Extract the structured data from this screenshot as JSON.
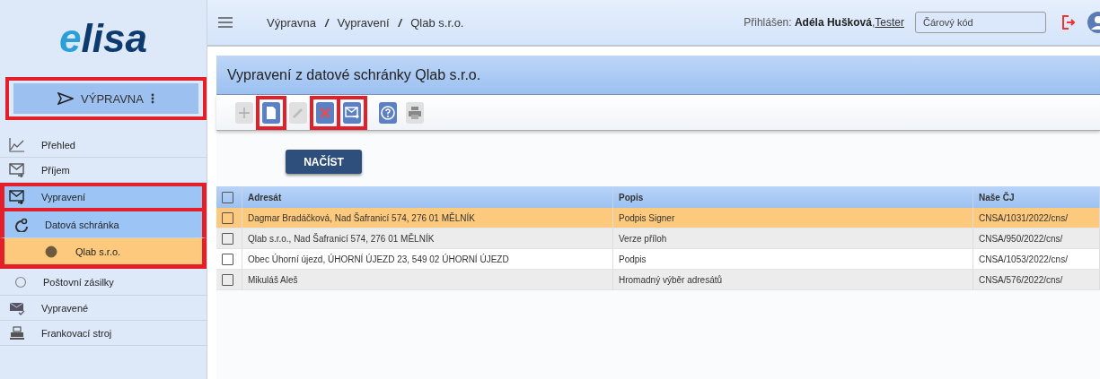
{
  "logo": {
    "text": "lisa",
    "mark": "e"
  },
  "sidebar": {
    "module_button": {
      "label": "VÝPRAVNA",
      "highlighted": true
    },
    "items": [
      {
        "label": "Přehled",
        "selected": false,
        "highlighted": false
      },
      {
        "label": "Příjem",
        "selected": false,
        "highlighted": false
      },
      {
        "label": "Vypravení",
        "selected": true,
        "highlighted": true,
        "children": [
          {
            "label": "Datová schránka",
            "selected": true,
            "highlighted": true,
            "children": [
              {
                "label": "Qlab s.r.o.",
                "selected": true,
                "highlighted": true
              }
            ]
          },
          {
            "label": "Poštovní zásilky",
            "selected": false,
            "highlighted": false
          }
        ]
      },
      {
        "label": "Vypravené",
        "selected": false,
        "highlighted": false
      },
      {
        "label": "Frankovací stroj",
        "selected": false,
        "highlighted": false
      }
    ]
  },
  "topbar": {
    "breadcrumbs": [
      "Výpravna",
      "Vypravení",
      "Qlab s.r.o."
    ],
    "separator": "/",
    "login_label": "Přihlášen:",
    "user": "Adéla Hušková",
    "role_separator": ",",
    "role": "Tester",
    "barcode_placeholder": "Čárový kód"
  },
  "panel": {
    "title": "Vypravení z datové schránky Qlab s.r.o.",
    "toolbar": [
      {
        "kind": "plus",
        "disabled": true,
        "highlighted": false
      },
      {
        "kind": "document",
        "disabled": false,
        "highlighted": true
      },
      {
        "kind": "pencil",
        "disabled": true,
        "highlighted": false
      },
      {
        "kind": "delete",
        "disabled": false,
        "highlighted": true
      },
      {
        "kind": "send",
        "disabled": false,
        "highlighted": true
      },
      {
        "kind": "help",
        "disabled": false,
        "highlighted": false
      },
      {
        "kind": "print",
        "disabled": true,
        "highlighted": false
      }
    ],
    "load_button": "NAČÍST",
    "table": {
      "all_checked": false,
      "columns": [
        "Adresát",
        "Popis",
        "Naše ČJ"
      ],
      "rows": [
        {
          "selected": true,
          "checked": false,
          "cells": [
            "Dagmar Bradáčková, Nad Šafranicí 574, 276 01 MĚLNÍK",
            "Podpis Signer",
            "CNSA/1031/2022/cns/"
          ]
        },
        {
          "selected": false,
          "checked": false,
          "cells": [
            "Qlab s.r.o., Nad Šafranicí 574, 276 01 MĚLNÍK",
            "Verze příloh",
            "CNSA/950/2022/cns/"
          ]
        },
        {
          "selected": false,
          "checked": false,
          "cells": [
            "Obec Úhorní újezd, ÚHORNÍ ÚJEZD 23, 549 02 ÚHORNÍ ÚJEZD",
            "Podpis",
            "CNSA/1053/2022/cns/"
          ]
        },
        {
          "selected": false,
          "checked": false,
          "cells": [
            "Mikuláš Aleš",
            "Hromadný výběr adresátů",
            "CNSA/576/2022/cns/"
          ]
        }
      ]
    }
  }
}
